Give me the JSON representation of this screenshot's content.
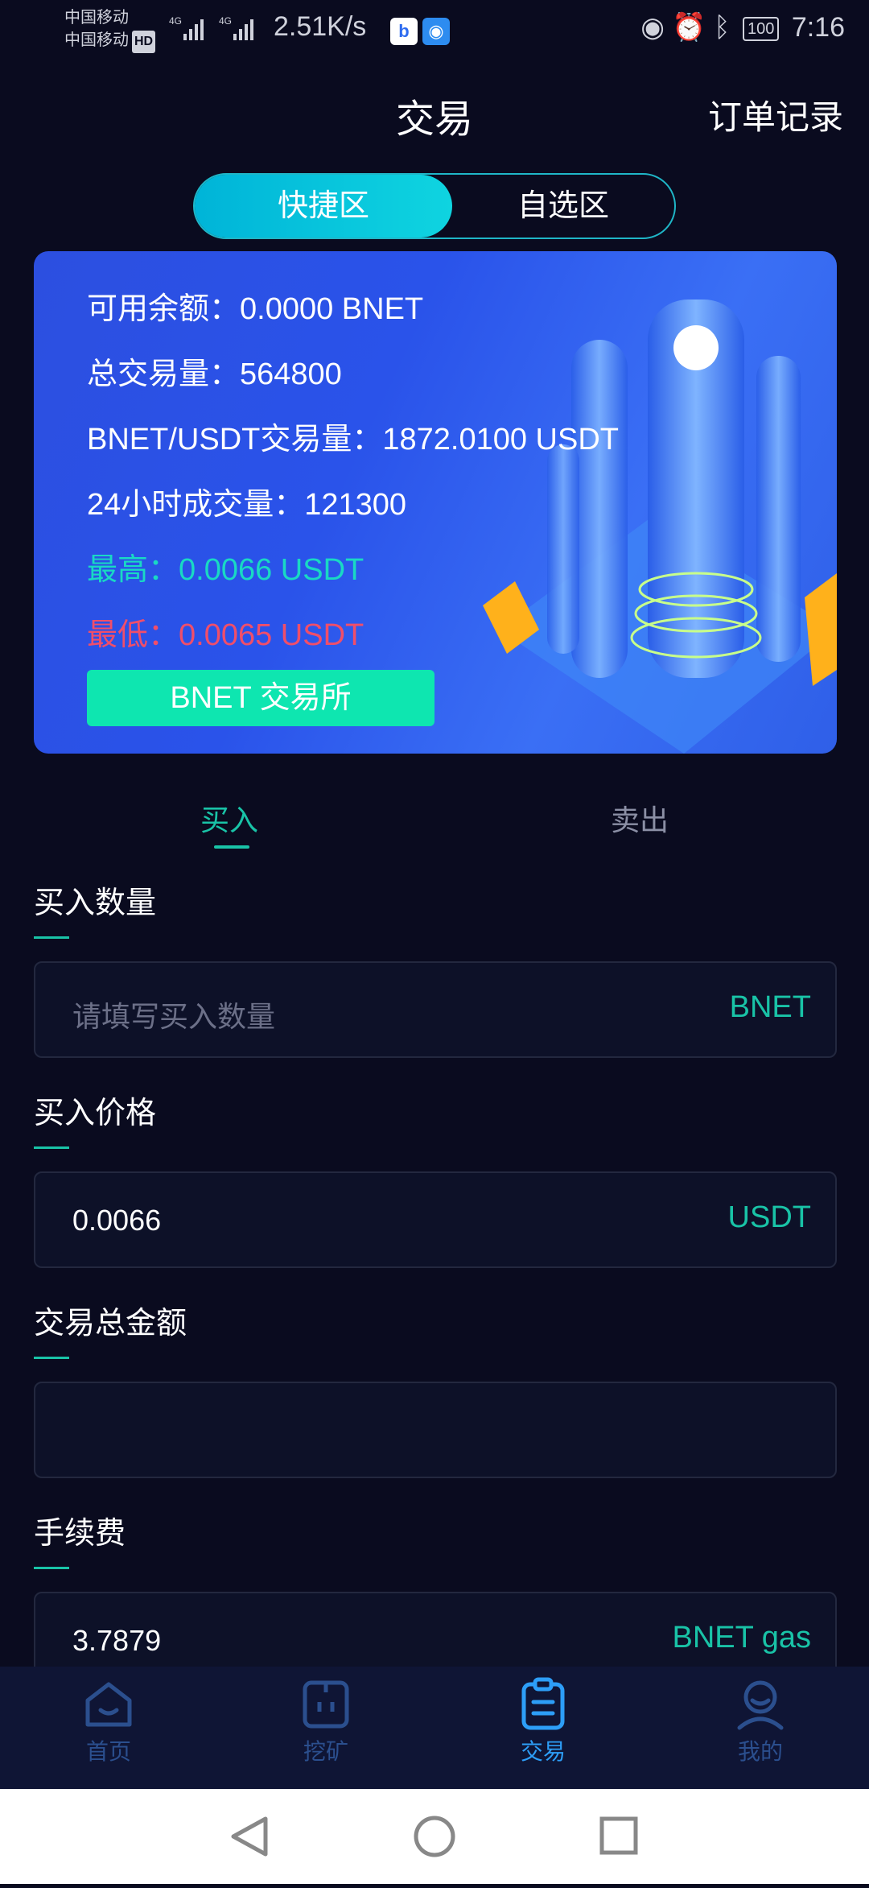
{
  "status_bar": {
    "carrier_1": "中国移动",
    "carrier_2": "中国移动",
    "hd": "HD",
    "net_1": "4G",
    "net_2": "4G",
    "speed": "2.51K/s",
    "battery": "100",
    "time": "7:16"
  },
  "header": {
    "title": "交易",
    "orders_label": "订单记录"
  },
  "segment": {
    "active": "快捷区",
    "inactive": "自选区"
  },
  "banner": {
    "available_balance": "可用余额：0.0000 BNET",
    "total_volume": "总交易量：564800",
    "pair_volume": "BNET/USDT交易量：1872.0100 USDT",
    "volume_24h": "24小时成交量：121300",
    "high": "最高：0.0066 USDT",
    "low": "最低：0.0065 USDT",
    "exchange_button": "BNET 交易所"
  },
  "trade_tabs": {
    "buy": "买入",
    "sell": "卖出"
  },
  "form": {
    "quantity_label": "买入数量",
    "quantity_placeholder": "请填写买入数量",
    "quantity_unit": "BNET",
    "price_label": "买入价格",
    "price_value": "0.0066",
    "price_unit": "USDT",
    "total_label": "交易总金额",
    "total_value": "",
    "fee_label": "手续费",
    "fee_value": "3.7879",
    "fee_unit": "BNET gas"
  },
  "bottom_nav": {
    "items": [
      {
        "label": "首页",
        "icon": "home-icon"
      },
      {
        "label": "挖矿",
        "icon": "mining-icon"
      },
      {
        "label": "交易",
        "icon": "clipboard-icon",
        "active": true
      },
      {
        "label": "我的",
        "icon": "user-icon"
      }
    ]
  },
  "colors": {
    "background": "#0a0b1f",
    "accent_green": "#19c3a7",
    "active_nav": "#2d9ef7",
    "low_red": "#f04e6a"
  }
}
